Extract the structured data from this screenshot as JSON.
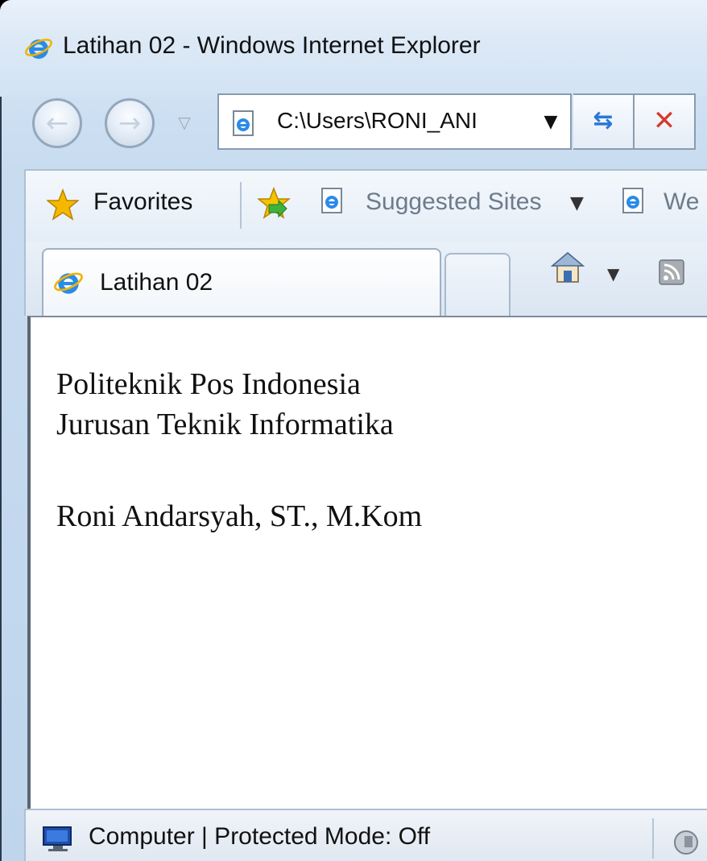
{
  "window": {
    "title": "Latihan 02 - Windows Internet Explorer"
  },
  "nav": {
    "back_icon": "back-arrow-icon",
    "forward_icon": "forward-arrow-icon",
    "address": "C:\\Users\\RONI_ANI"
  },
  "favorites_bar": {
    "favorites_label": "Favorites",
    "suggested_sites_label": "Suggested Sites",
    "web_slice_label": "We"
  },
  "tabs": [
    {
      "label": "Latihan 02"
    }
  ],
  "page": {
    "line1": "Politeknik Pos Indonesia",
    "line2": "Jurusan Teknik Informatika",
    "line3": "Roni Andarsyah, ST., M.Kom"
  },
  "status": {
    "text": "Computer | Protected Mode: Off"
  },
  "colors": {
    "accent": "#2a78d6",
    "stop": "#d43b2a",
    "star": "#f5b800"
  }
}
